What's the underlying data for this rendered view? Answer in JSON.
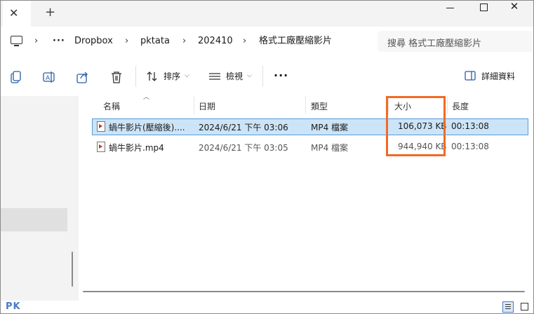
{
  "tab": {
    "close": "✕",
    "new": "+"
  },
  "window": {
    "close": "✕"
  },
  "breadcrumb": {
    "sep": "›",
    "more": "···",
    "items": [
      "Dropbox",
      "pktata",
      "202410",
      "格式工廠壓縮影片"
    ]
  },
  "search": {
    "placeholder": "搜尋 格式工廠壓縮影片"
  },
  "toolbar": {
    "sort_label": "排序",
    "view_label": "檢視",
    "more": "···",
    "details_label": "詳細資料"
  },
  "columns": [
    "名稱",
    "日期",
    "類型",
    "大小",
    "長度"
  ],
  "files": [
    {
      "name": "蝸牛影片(壓縮後)....",
      "date": "2024/6/21 下午 03:06",
      "type": "MP4 檔案",
      "size": "106,073 KB",
      "length": "00:13:08",
      "selected": true
    },
    {
      "name": "蝸牛影片.mp4",
      "date": "2024/6/21 下午 03:05",
      "type": "MP4 檔案",
      "size": "944,940 KB",
      "length": "00:13:08",
      "selected": false
    }
  ],
  "watermark": "PK",
  "colors": {
    "highlight": "#f26a26",
    "selection": "#cce4f7",
    "accent": "#4a7ac9"
  },
  "icons": [
    "copy-icon",
    "rename-icon",
    "share-icon",
    "delete-icon",
    "sort-icon",
    "view-icon",
    "details-pane-icon",
    "video-file-icon",
    "computer-icon"
  ]
}
